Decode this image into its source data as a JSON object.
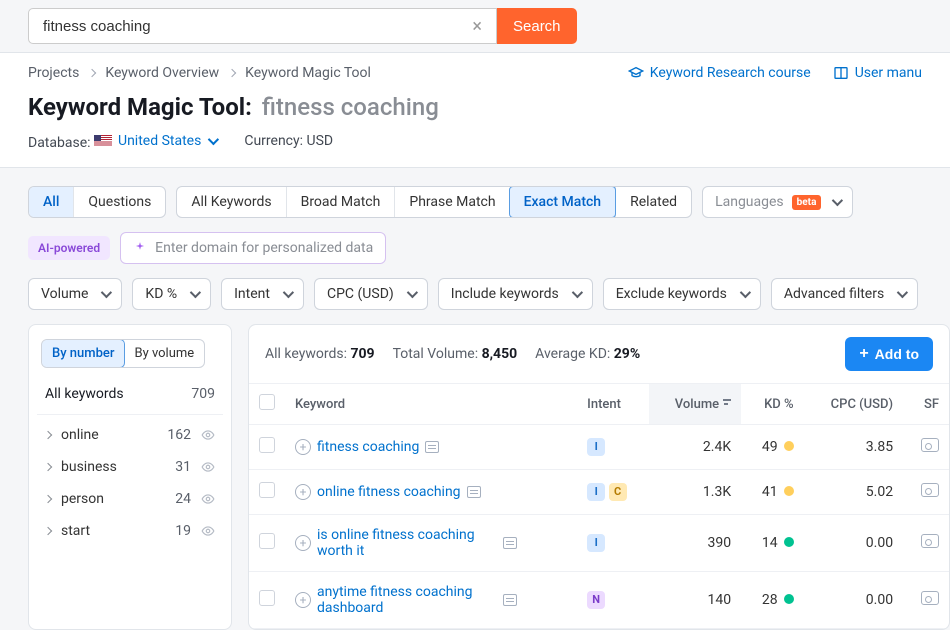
{
  "search": {
    "value": "fitness coaching",
    "button": "Search"
  },
  "breadcrumbs": [
    "Projects",
    "Keyword Overview",
    "Keyword Magic Tool"
  ],
  "header_links": {
    "course": "Keyword Research course",
    "manual": "User manu"
  },
  "title_tool": "Keyword Magic Tool:",
  "title_query": "fitness coaching",
  "meta": {
    "db_label": "Database:",
    "db_value": "United States",
    "curr_label": "Currency:",
    "curr_value": "USD"
  },
  "tabs1": {
    "all": "All",
    "questions": "Questions"
  },
  "tabs2": [
    "All Keywords",
    "Broad Match",
    "Phrase Match",
    "Exact Match",
    "Related"
  ],
  "tabs2_active": "Exact Match",
  "languages": {
    "label": "Languages",
    "badge": "beta"
  },
  "ai": {
    "badge": "AI-powered",
    "placeholder": "Enter domain for personalized data"
  },
  "filters": [
    "Volume",
    "KD %",
    "Intent",
    "CPC (USD)",
    "Include keywords",
    "Exclude keywords",
    "Advanced filters"
  ],
  "sidebar": {
    "seg": [
      "By number",
      "By volume"
    ],
    "all_label": "All keywords",
    "all_count": "709",
    "groups": [
      {
        "name": "online",
        "count": "162"
      },
      {
        "name": "business",
        "count": "31"
      },
      {
        "name": "person",
        "count": "24"
      },
      {
        "name": "start",
        "count": "19"
      }
    ]
  },
  "stats": {
    "all_kw_label": "All keywords:",
    "all_kw": "709",
    "vol_label": "Total Volume:",
    "vol": "8,450",
    "kd_label": "Average KD:",
    "kd": "29%",
    "add_btn": "Add to "
  },
  "columns": {
    "keyword": "Keyword",
    "intent": "Intent",
    "volume": "Volume",
    "kd": "KD %",
    "cpc": "CPC (USD)",
    "sf": "SF"
  },
  "rows": [
    {
      "kw": "fitness coaching",
      "intents": [
        "I"
      ],
      "vol": "2.4K",
      "kd": "49",
      "kd_c": "y",
      "cpc": "3.85"
    },
    {
      "kw": "online fitness coaching",
      "intents": [
        "I",
        "C"
      ],
      "vol": "1.3K",
      "kd": "41",
      "kd_c": "y",
      "cpc": "5.02"
    },
    {
      "kw": "is online fitness coaching worth it",
      "intents": [
        "I"
      ],
      "vol": "390",
      "kd": "14",
      "kd_c": "g",
      "cpc": "0.00"
    },
    {
      "kw": "anytime fitness coaching dashboard",
      "intents": [
        "N"
      ],
      "vol": "140",
      "kd": "28",
      "kd_c": "g",
      "cpc": "0.00"
    }
  ]
}
